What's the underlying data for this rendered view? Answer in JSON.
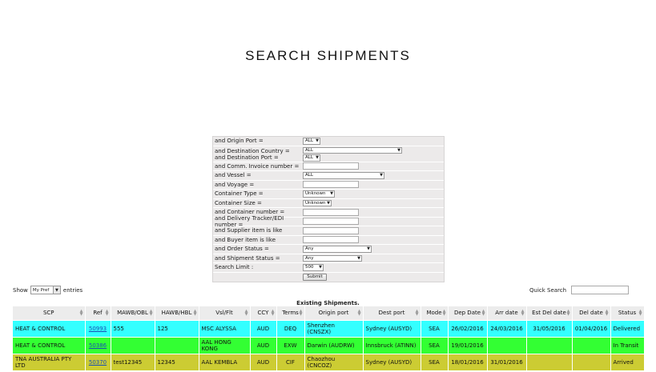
{
  "page": {
    "title": "SEARCH SHIPMENTS"
  },
  "form": {
    "origin_port": {
      "label": "and Origin Port =",
      "value": "ALL"
    },
    "dest_country": {
      "label": "and Destination Country =",
      "value": "ALL"
    },
    "dest_port": {
      "label": "and Destination Port =",
      "value": "ALL"
    },
    "invoice": {
      "label": "and Comm. Invoice number ="
    },
    "vessel": {
      "label": "and Vessel =",
      "value": "ALL"
    },
    "voyage": {
      "label": "and Voyage ="
    },
    "container_type": {
      "label": "Container Type =",
      "value": "Unknown"
    },
    "container_size": {
      "label": "Container Size =",
      "value": "Unknown"
    },
    "container_number": {
      "label": "and Container number ="
    },
    "delivery_tracker": {
      "label": "and Delivery Tracker/EDI number ="
    },
    "supplier_item": {
      "label": "and Supplier item is like"
    },
    "buyer_item": {
      "label": "and Buyer item is like"
    },
    "order_status": {
      "label": "and Order Status =",
      "value": "Any"
    },
    "shipment_status": {
      "label": "and Shipment Status =",
      "value": "Any"
    },
    "search_limit": {
      "label": "Search Limit :",
      "value": "500"
    },
    "submit_label": "Submit"
  },
  "table_controls": {
    "show_label": "Show",
    "length_value": "My Pref",
    "entries_label": "entries",
    "quick_search_label": "Quick Search"
  },
  "table": {
    "caption": "Existing Shipments.",
    "columns": [
      "SCP",
      "Ref",
      "MAWB/OBL",
      "HAWB/HBL",
      "Vsl/Flt",
      "CCY",
      "Terms",
      "Origin port",
      "Dest port",
      "Mode",
      "Dep Date",
      "Arr date",
      "Est Del date",
      "Del date",
      "Status"
    ],
    "rows": [
      {
        "color": "#33ffff",
        "cells": [
          "HEAT & CONTROL",
          "50993",
          "555",
          "125",
          "MSC ALYSSA",
          "AUD",
          "DEQ",
          "Shenzhen (CNSZX)",
          "Sydney (AUSYD)",
          "SEA",
          "26/02/2016",
          "24/03/2016",
          "31/05/2016",
          "01/04/2016",
          "Delivered"
        ]
      },
      {
        "color": "#33ff33",
        "cells": [
          "HEAT & CONTROL",
          "50386",
          "",
          "",
          "AAL HONG KONG",
          "AUD",
          "EXW",
          "Darwin (AUDRW)",
          "Innsbruck (ATINN)",
          "SEA",
          "19/01/2016",
          "",
          "",
          "",
          "In Transit"
        ]
      },
      {
        "color": "#cccc33",
        "cells": [
          "TNA AUSTRALIA PTY LTD",
          "50370",
          "test12345",
          "12345",
          "AAL KEMBLA",
          "AUD",
          "CIF",
          "Chaozhou (CNCOZ)",
          "Sydney (AUSYD)",
          "SEA",
          "18/01/2016",
          "31/01/2016",
          "",
          "",
          "Arrived"
        ]
      }
    ]
  }
}
